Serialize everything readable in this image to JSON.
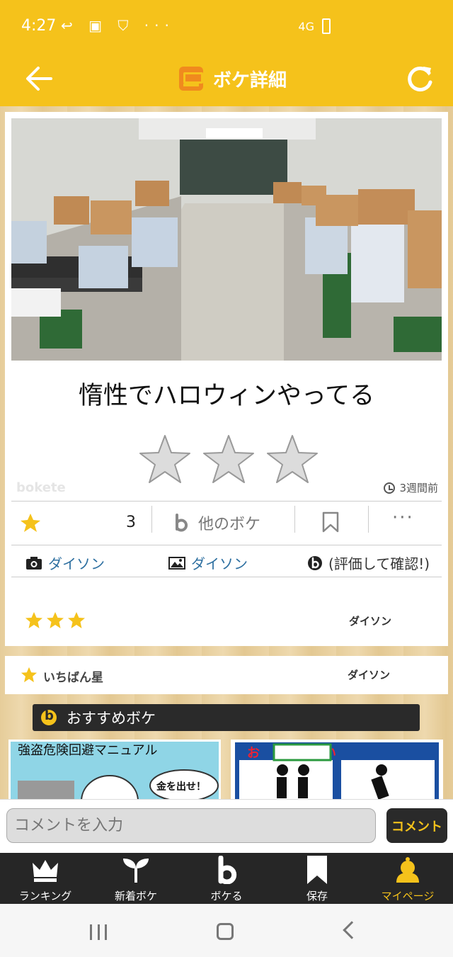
{
  "status_bar": {
    "time": "4:27",
    "left_icons": "↩ ▣ ⛉ ···",
    "network": "4G"
  },
  "header": {
    "title": "ボケ詳細"
  },
  "post": {
    "caption": "惰性でハロウィンやってる",
    "brand": "bokete",
    "time_ago": "3週間前",
    "star_count": "3",
    "other_bokes_label": "他のボケ",
    "more_label": "···",
    "photo_credit": "ダイソン",
    "boke_credit": "ダイソン",
    "evaluate_label": "(評価して確認!)",
    "rating_stars": 3,
    "rater_name": "ダイソン"
  },
  "best_star": {
    "label": "いちばん星",
    "name": "ダイソン"
  },
  "recommend": {
    "label": "おすすめボケ"
  },
  "thumbnails": [
    {
      "text": "強盗危険回避マニュアル",
      "bubble": "金を出せ！"
    },
    {
      "text": "お　　かけない"
    }
  ],
  "comment": {
    "placeholder": "コメントを入力",
    "button": "コメント"
  },
  "bottom_nav": {
    "items": [
      {
        "label": "ランキング",
        "icon": "crown-icon"
      },
      {
        "label": "新着ボケ",
        "icon": "sprout-icon"
      },
      {
        "label": "ボケる",
        "icon": "b-icon"
      },
      {
        "label": "保存",
        "icon": "bookmark-icon"
      },
      {
        "label": "マイページ",
        "icon": "user-icon",
        "active": true
      }
    ]
  },
  "colors": {
    "brand_yellow": "#f5c21b",
    "star_gold": "#f5c21b",
    "dark": "#262626"
  }
}
